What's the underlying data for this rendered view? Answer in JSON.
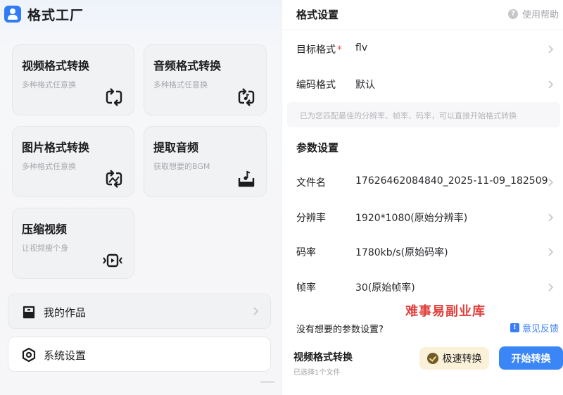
{
  "app": {
    "title": "格式工厂"
  },
  "tools": [
    {
      "title": "视频格式转换",
      "subtitle": "多种格式任意换",
      "icon": "swap-video-icon"
    },
    {
      "title": "音频格式转换",
      "subtitle": "多种格式任意换",
      "icon": "swap-audio-icon"
    },
    {
      "title": "图片格式转换",
      "subtitle": "多种格式任意换",
      "icon": "swap-image-icon"
    },
    {
      "title": "提取音频",
      "subtitle": "获取想要的BGM",
      "icon": "extract-audio-icon"
    },
    {
      "title": "压缩视频",
      "subtitle": "让视频瘦个身",
      "icon": "compress-video-icon"
    }
  ],
  "rows": {
    "works": {
      "label": "我的作品",
      "icon": "folder-icon"
    },
    "settings": {
      "label": "系统设置",
      "icon": "settings-icon"
    }
  },
  "panel": {
    "title": "格式设置",
    "help": "使用帮助",
    "target_format": {
      "label": "目标格式",
      "required": "*",
      "value": "flv"
    },
    "codec": {
      "label": "编码格式",
      "value": "默认"
    },
    "hint": "已为您匹配最佳的分辨率、帧率、码率，可以直接开始格式转换",
    "params_title": "参数设置",
    "params": [
      {
        "label": "文件名",
        "value": "17626462084840_2025-11-09_182509"
      },
      {
        "label": "分辨率",
        "value": "1920*1080(原始分辨率)"
      },
      {
        "label": "码率",
        "value": "1780kb/s(原始码率)"
      },
      {
        "label": "帧率",
        "value": "30(原始帧率)"
      }
    ],
    "watermark": "难事易副业库",
    "question": "没有想要的参数设置?",
    "feedback": "意见反馈",
    "bottom": {
      "title": "视频格式转换",
      "subtitle": "已选择1个文件",
      "fast_label": "极速转换",
      "start_label": "开始转换"
    }
  },
  "colors": {
    "accent": "#3b86f7",
    "required": "#f04b4b",
    "watermark": "#e0403c",
    "fast_bg": "#fbf1d9"
  }
}
